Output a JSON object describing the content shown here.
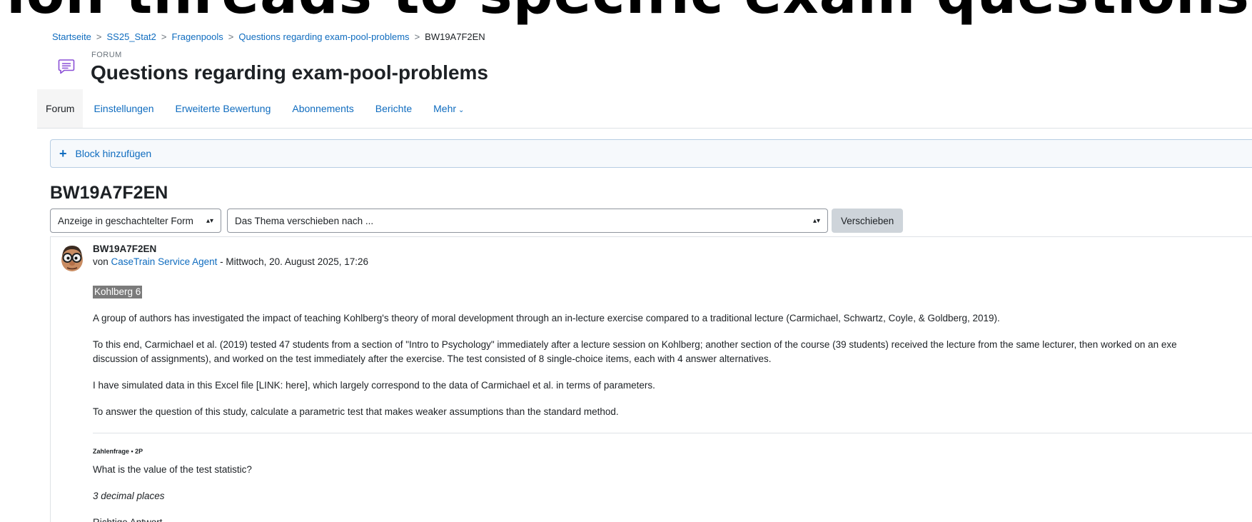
{
  "overlay": {
    "title": "ion threads to specific exam questions"
  },
  "breadcrumb": {
    "items": [
      "Startseite",
      "SS25_Stat2",
      "Fragenpools",
      "Questions regarding exam-pool-problems"
    ],
    "separator": ">",
    "current": "BW19A7F2EN"
  },
  "header": {
    "icon": "forum-chat-icon",
    "activity_type": "FORUM",
    "title": "Questions regarding exam-pool-problems"
  },
  "nav": {
    "tabs": [
      {
        "label": "Forum",
        "active": true
      },
      {
        "label": "Einstellungen"
      },
      {
        "label": "Erweiterte Bewertung"
      },
      {
        "label": "Abonnements"
      },
      {
        "label": "Berichte"
      },
      {
        "label": "Mehr",
        "icon": "chevron-down-icon"
      }
    ]
  },
  "add_block": {
    "label": "Block hinzufügen"
  },
  "discussion": {
    "title": "BW19A7F2EN",
    "display_mode": "Anzeige in geschachtelter Form",
    "move_placeholder": "Das Thema verschieben nach ...",
    "move_button": "Verschieben"
  },
  "post": {
    "subject": "BW19A7F2EN",
    "by_prefix": "von",
    "author": "CaseTrain Service Agent",
    "date": " - Mittwoch, 20. August 2025, 17:26",
    "tag": "Kohlberg 6",
    "paragraphs": [
      "A group of authors has investigated the impact of teaching Kohlberg's theory of moral development through an in-lecture exercise compared to a traditional lecture (Carmichael, Schwartz, Coyle, & Goldberg, 2019).",
      "To this end, Carmichael et al. (2019) tested 47 students from a section of \"Intro to Psychology\" immediately after a lecture session on Kohlberg; another section of the course (39 students) received the lecture from the same lecturer, then worked on an exe",
      "discussion of assignments), and worked on the test immediately after the exercise. The test consisted of 8 single-choice items, each with 4 answer alternatives.",
      "I have simulated data in this Excel file [LINK: here], which largely correspond to the data of Carmichael et al. in terms of parameters.",
      "To answer the question of this study, calculate a parametric test that makes weaker assumptions than the standard method."
    ],
    "question_type": "Zahlenfrage • 2P",
    "question": "What is the value of the test statistic?",
    "precision": "3 decimal places",
    "cut_line": "Richtige Antwort"
  }
}
